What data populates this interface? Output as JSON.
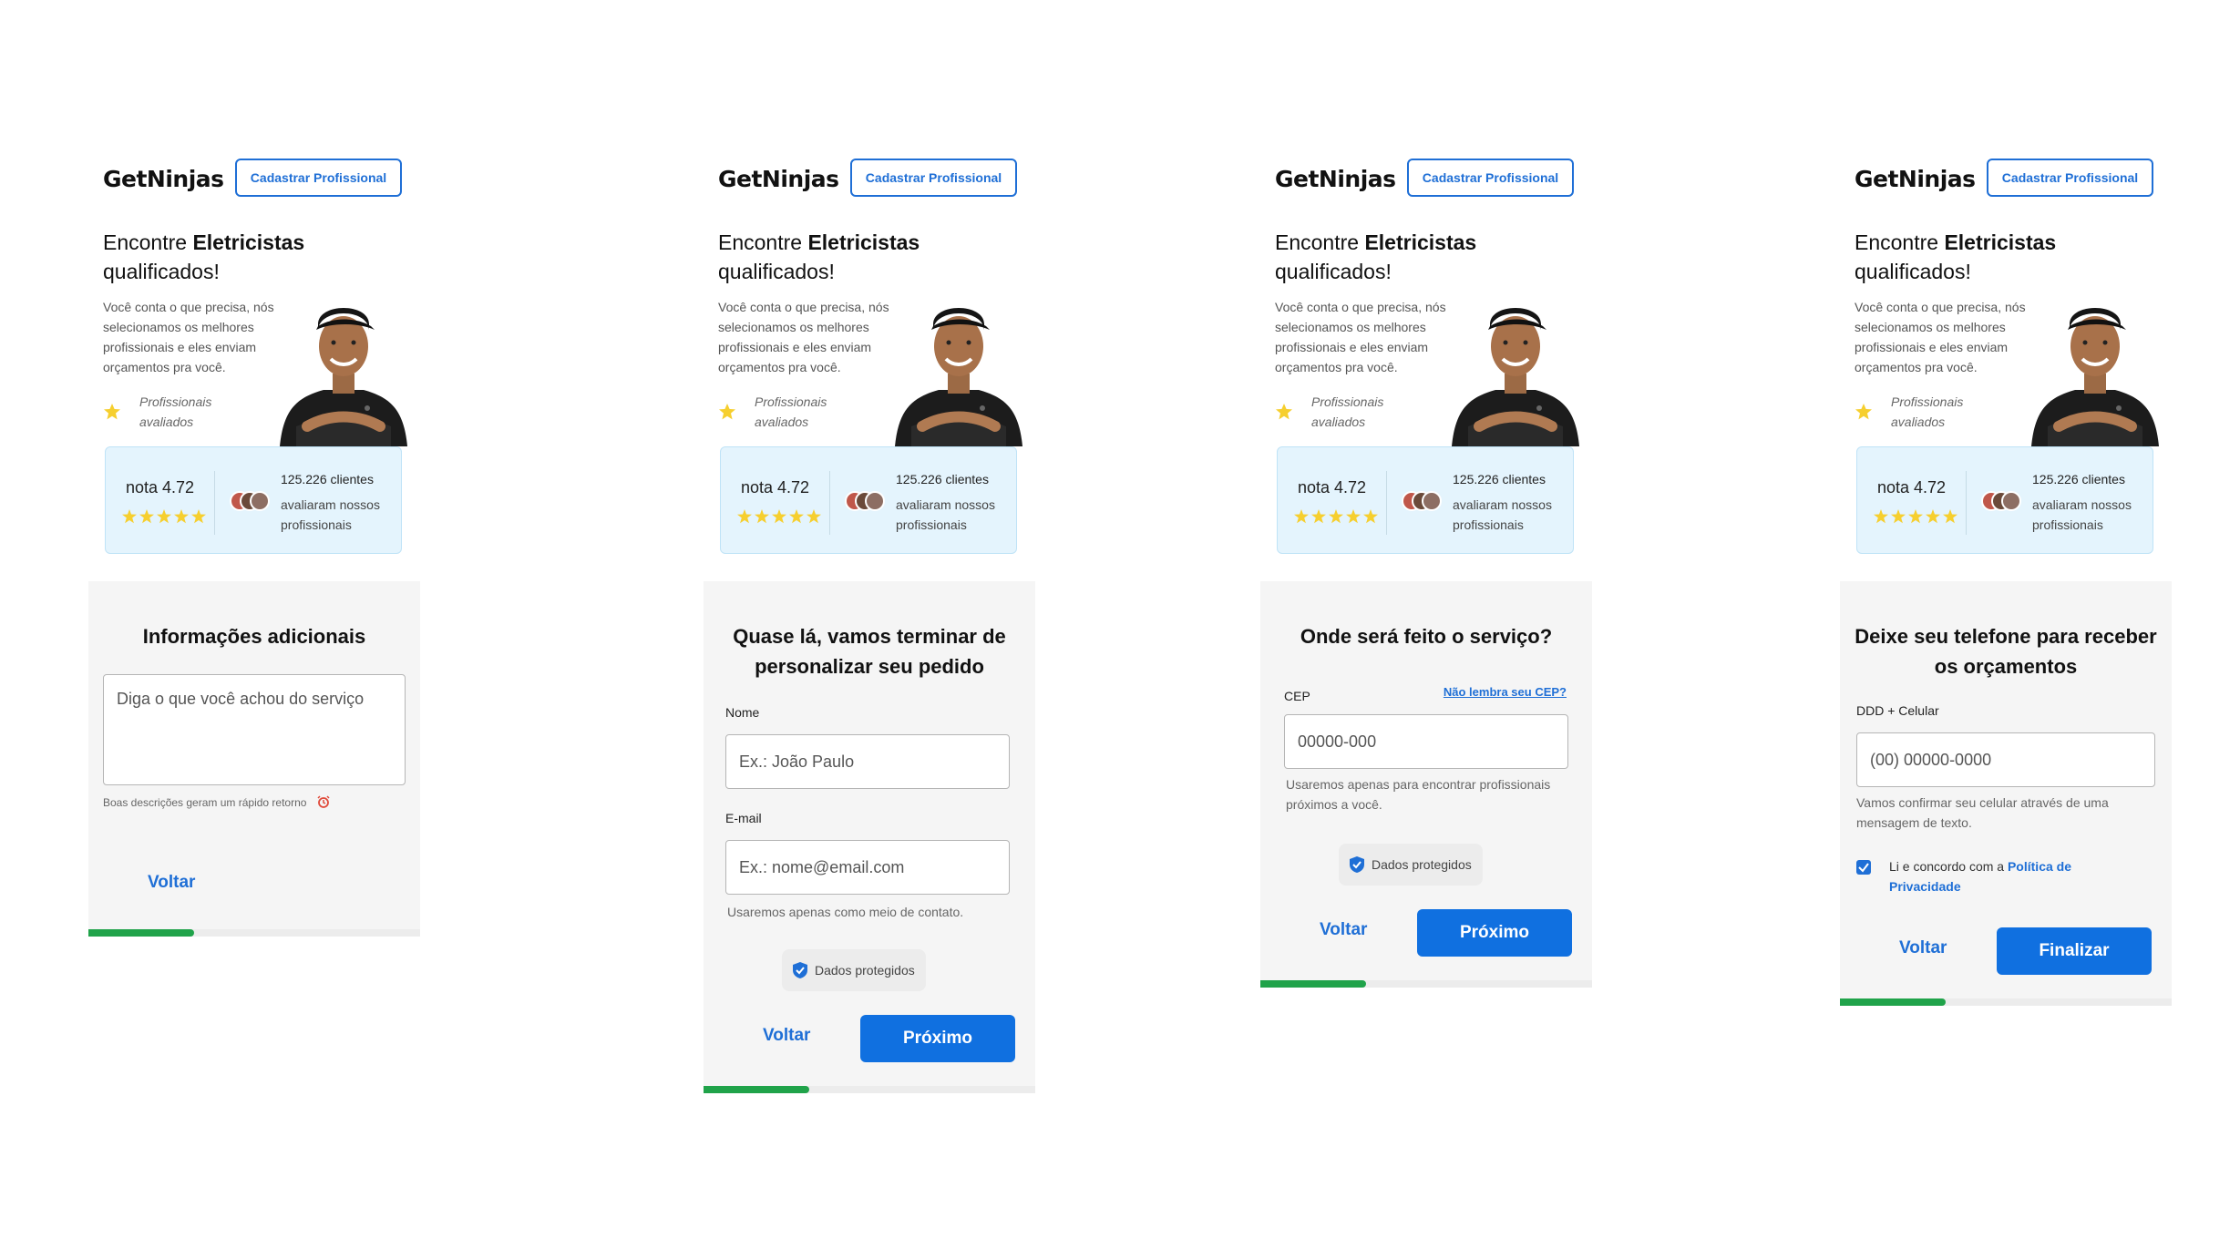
{
  "brand": {
    "logo": "GetNinjas",
    "cadastrar_label": "Cadastrar Profissional"
  },
  "hero": {
    "title_prefix": "Encontre ",
    "title_bold": "Eletricistas",
    "title_suffix": "qualificados!",
    "description": "Você conta o que precisa, nós selecionamos os melhores profissionais e eles enviam orçamentos pra você.",
    "badge": "Profissionais avaliados"
  },
  "rating": {
    "nota_label": "nota 4.72",
    "stars": 5,
    "clients_count": "125.226 clientes",
    "clients_text": "avaliaram nossos profissionais"
  },
  "colors": {
    "primary": "#1070e0",
    "progress": "#20a34a",
    "card_bg": "#e4f4fd"
  },
  "screens": [
    {
      "title": "Informações adicionais",
      "textarea_placeholder": "Diga o que você achou do serviço",
      "hint": "Boas descrições geram um rápido retorno",
      "hint_icon": "alarm-clock-icon",
      "back_label": "Voltar",
      "progress": 0.32
    },
    {
      "title": "Quase lá, vamos terminar de personalizar seu pedido",
      "name_label": "Nome",
      "name_placeholder": "Ex.: João Paulo",
      "email_label": "E-mail",
      "email_placeholder": "Ex.: nome@email.com",
      "email_help": "Usaremos apenas como meio de contato.",
      "safe_label": "Dados  protegidos",
      "back_label": "Voltar",
      "next_label": "Próximo",
      "progress": 0.32
    },
    {
      "title": "Onde será feito o serviço?",
      "cep_label": "CEP",
      "cep_link": "Não lembra seu CEP?",
      "cep_placeholder": "00000-000",
      "cep_help": "Usaremos apenas para encontrar profissionais próximos a você.",
      "safe_label": "Dados  protegidos",
      "back_label": "Voltar",
      "next_label": "Próximo",
      "progress": 0.32
    },
    {
      "title": "Deixe seu telefone para receber os orçamentos",
      "phone_label": "DDD + Celular",
      "phone_placeholder": "(00) 00000-0000",
      "phone_help": "Vamos confirmar seu celular através de uma mensagem de texto.",
      "terms_prefix": "Li e concordo com a ",
      "terms_link": "Política de Privacidade",
      "back_label": "Voltar",
      "finish_label": "Finalizar",
      "progress": 0.32
    }
  ]
}
